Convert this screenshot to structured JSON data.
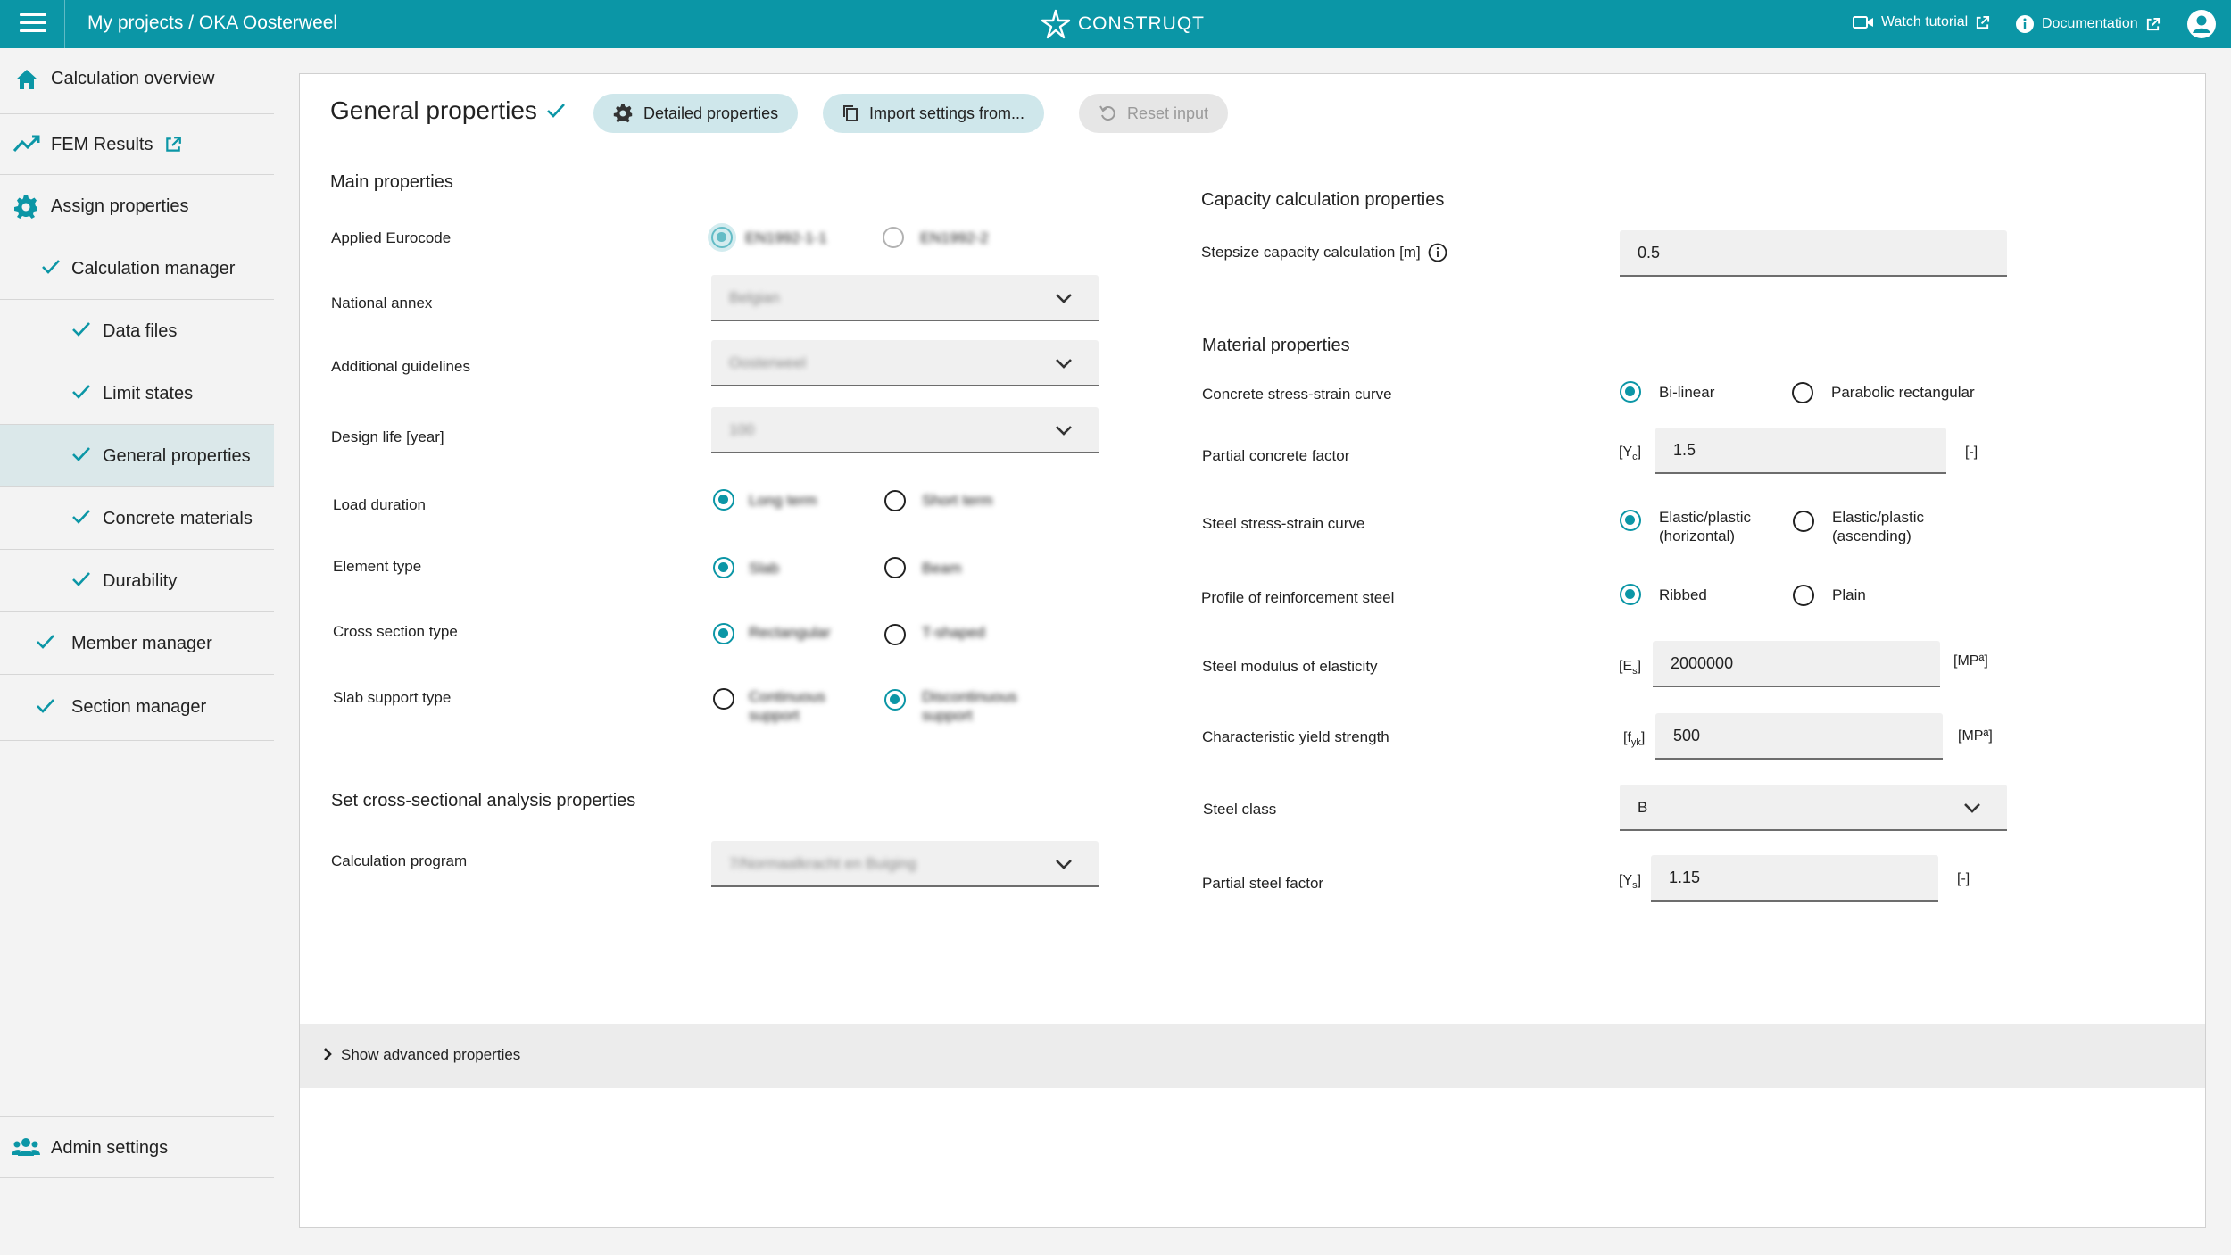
{
  "topbar": {
    "breadcrumb": "My projects / OKA Oosterweel",
    "logo_text": "CONSTRUQT",
    "watch_tutorial": "Watch tutorial",
    "documentation": "Documentation"
  },
  "sidebar": {
    "calculation_overview": "Calculation overview",
    "fem_results": "FEM Results",
    "assign_properties": "Assign properties",
    "calculation_manager": "Calculation manager",
    "data_files": "Data files",
    "limit_states": "Limit states",
    "general_properties": "General properties",
    "concrete_materials": "Concrete materials",
    "durability": "Durability",
    "member_manager": "Member manager",
    "section_manager": "Section manager",
    "admin_settings": "Admin settings"
  },
  "header": {
    "title": "General properties",
    "detailed_properties": "Detailed properties",
    "import_settings": "Import settings from...",
    "reset_input": "Reset input"
  },
  "main": {
    "section_title": "Main properties",
    "applied_eurocode": {
      "label": "Applied Eurocode",
      "opt1": "EN1992-1-1",
      "opt2": "EN1992-2"
    },
    "national_annex": {
      "label": "National annex",
      "value": "Belgian"
    },
    "additional_guidelines": {
      "label": "Additional guidelines",
      "value": "Oosterweel"
    },
    "design_life": {
      "label": "Design life [year]",
      "value": "100"
    },
    "load_duration": {
      "label": "Load duration",
      "opt1": "Long term",
      "opt2": "Short term"
    },
    "element_type": {
      "label": "Element type",
      "opt1": "Slab",
      "opt2": "Beam"
    },
    "cross_section_type": {
      "label": "Cross section type",
      "opt1": "Rectangular",
      "opt2": "T-shaped"
    },
    "slab_support_type": {
      "label": "Slab support type",
      "opt1a": "Continuous",
      "opt1b": "support",
      "opt2a": "Discontinuous",
      "opt2b": "support"
    }
  },
  "analysis": {
    "section_title": "Set cross-sectional analysis properties",
    "calculation_program": {
      "label": "Calculation program",
      "value": "7/Normaalkracht en Buiging"
    }
  },
  "capacity": {
    "section_title": "Capacity calculation properties",
    "stepsize": {
      "label": "Stepsize capacity calculation [m]",
      "value": "0.5"
    }
  },
  "material": {
    "section_title": "Material properties",
    "concrete_curve": {
      "label": "Concrete stress-strain curve",
      "opt1": "Bi-linear",
      "opt2": "Parabolic rectangular"
    },
    "partial_concrete": {
      "label": "Partial concrete factor",
      "symbol": "[Y",
      "sub": "c",
      "close": "]",
      "value": "1.5",
      "unit": "[-]"
    },
    "steel_curve": {
      "label": "Steel stress-strain curve",
      "opt1a": "Elastic/plastic",
      "opt1b": "(horizontal)",
      "opt2a": "Elastic/plastic",
      "opt2b": "(ascending)"
    },
    "profile": {
      "label": "Profile of reinforcement steel",
      "opt1": "Ribbed",
      "opt2": "Plain"
    },
    "modulus": {
      "label": "Steel modulus of elasticity",
      "symbol": "[E",
      "sub": "s",
      "close": "]",
      "value": "2000000",
      "unit": "[MPª]"
    },
    "yield": {
      "label": "Characteristic yield strength",
      "symbol": "[f",
      "sub": "yk",
      "close": "]",
      "value": "500",
      "unit": "[MPª]"
    },
    "steel_class": {
      "label": "Steel class",
      "value": "B"
    },
    "partial_steel": {
      "label": "Partial steel factor",
      "symbol": "[Y",
      "sub": "s",
      "close": "]",
      "value": "1.15",
      "unit": "[-]"
    }
  },
  "advanced": {
    "label": "Show advanced properties"
  },
  "colors": {
    "brand": "#0b96a6",
    "pill": "#cfe7eb",
    "active_nav": "#dbe8ea"
  }
}
